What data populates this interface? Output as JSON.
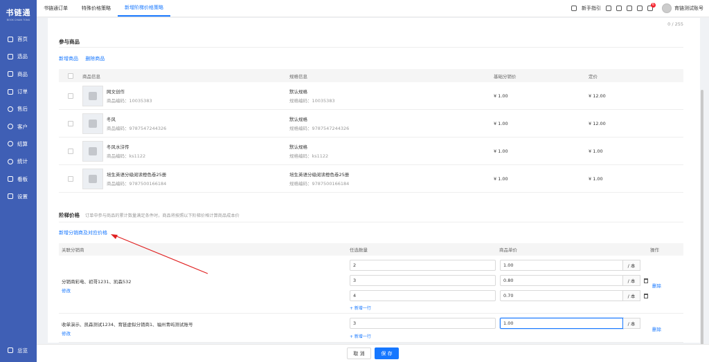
{
  "sidebar": {
    "logo": "书链通",
    "logo_sub": "BOOK CHAIN TONG",
    "items": [
      {
        "label": "首页",
        "icon": "monitor-icon"
      },
      {
        "label": "选品",
        "icon": "select-icon"
      },
      {
        "label": "商品",
        "icon": "box-icon"
      },
      {
        "label": "订单",
        "icon": "order-icon"
      },
      {
        "label": "售后",
        "icon": "service-icon"
      },
      {
        "label": "客户",
        "icon": "user-icon"
      },
      {
        "label": "结算",
        "icon": "settle-icon"
      },
      {
        "label": "统计",
        "icon": "stats-icon"
      },
      {
        "label": "看板",
        "icon": "dashboard-icon"
      },
      {
        "label": "设置",
        "icon": "settings-icon"
      }
    ],
    "bottom": "总览"
  },
  "topnav": {
    "tabs": [
      "书链通订单",
      "特殊价格策略",
      "新增阶梯价格策略"
    ],
    "guide": "新手指引",
    "badge": "6",
    "account": "育链测试账号"
  },
  "main": {
    "counter": "0 / 255",
    "section_title": "参与商品",
    "link_add": "新增商品",
    "link_delete": "删除商品",
    "table_headers": [
      "商品信息",
      "规格信息",
      "基础分销价",
      "定价"
    ],
    "products": [
      {
        "name": "网文创作",
        "code": "商品编码：10035383",
        "spec": "默认规格",
        "spec_code": "规格编码：10035383",
        "base_price": "¥ 1.00",
        "price": "¥ 12.00"
      },
      {
        "name": "冬风",
        "code": "商品编码：9787547244326",
        "spec": "默认规格",
        "spec_code": "规格编码：9787547244326",
        "base_price": "¥ 1.00",
        "price": "¥ 12.00"
      },
      {
        "name": "冬风水浒传",
        "code": "商品编码：ks1122",
        "spec": "默认规格",
        "spec_code": "规格编码：ks1122",
        "base_price": "¥ 1.00",
        "price": "¥ 1.00"
      },
      {
        "name": "培生英语分级阅读橙色卷25册",
        "code": "商品编码：9787500166184",
        "spec": "培生英语分级阅读橙色卷25册",
        "spec_code": "规格编码：9787500166184",
        "base_price": "¥ 1.00",
        "price": "¥ 1.00"
      }
    ],
    "ladder_title": "阶梯价格",
    "ladder_desc": "订单中参与商品的累计数量满足条件时，商品将按照以下阶梯价格计算商品成本价",
    "add_distributor": "新增分销商及对应价格",
    "ladder_headers": [
      "关联分销商",
      "任选数量",
      "商品单价",
      "操作"
    ],
    "unit": "/ 本",
    "add_row": "+ 新增一行",
    "edit_label": "修改",
    "delete_label": "删除",
    "groups": [
      {
        "distributors": "分销商彩电、初哥1231、凯森532",
        "rows": [
          {
            "qty": "2",
            "price": "1.00"
          },
          {
            "qty": "3",
            "price": "0.80"
          },
          {
            "qty": "4",
            "price": "0.70"
          }
        ]
      },
      {
        "distributors": "收单演示、凯森测试1234、育链虚拟分销商1、福州青屿测试账号",
        "rows": [
          {
            "qty": "3",
            "price": "1.00"
          }
        ]
      }
    ]
  },
  "footer": {
    "cancel": "取 消",
    "save": "保 存"
  },
  "colors": {
    "sidebar": "#3f5fb5",
    "accent": "#1677ff",
    "annotation": "#e02020"
  }
}
